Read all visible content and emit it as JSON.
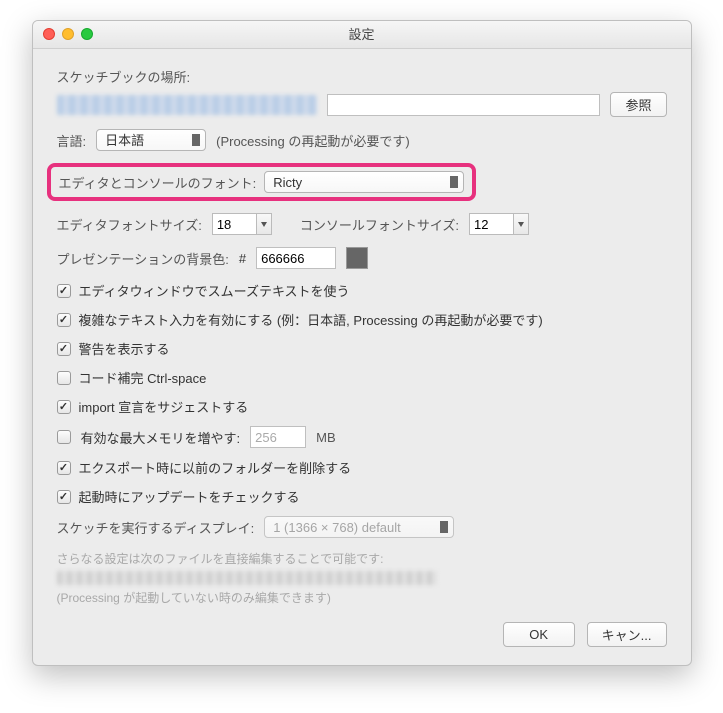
{
  "window": {
    "title": "設定"
  },
  "sketchbook": {
    "label": "スケッチブックの場所:",
    "browse": "参照"
  },
  "language": {
    "label": "言語:",
    "value": "日本語",
    "hint": "(Processing の再起動が必要です)"
  },
  "font": {
    "label": "エディタとコンソールのフォント:",
    "value": "Ricty"
  },
  "fontSize": {
    "editorLabel": "エディタフォントサイズ:",
    "editorValue": "18",
    "consoleLabel": "コンソールフォントサイズ:",
    "consoleValue": "12"
  },
  "presentation": {
    "label": "プレゼンテーションの背景色:",
    "hash": "#",
    "value": "666666"
  },
  "checks": {
    "smooth": "エディタウィンドウでスムーズテキストを使う",
    "complex": "複雑なテキスト入力を有効にする (例：日本語, Processing の再起動が必要です)",
    "warnings": "警告を表示する",
    "codeCompletion": "コード補完 Ctrl-space",
    "importSuggest": "import 宣言をサジェストする",
    "memory": "有効な最大メモリを増やす:",
    "memoryValue": "256",
    "memoryUnit": "MB",
    "deleteFolder": "エクスポート時に以前のフォルダーを削除する",
    "checkUpdates": "起動時にアップデートをチェックする"
  },
  "display": {
    "label": "スケッチを実行するディスプレイ:",
    "value": "1 (1366 × 768) default"
  },
  "notes": {
    "line1": "さらなる設定は次のファイルを直接編集することで可能です:",
    "line3": "(Processing が起動していない時のみ編集できます)"
  },
  "buttons": {
    "ok": "OK",
    "cancel": "キャン..."
  }
}
